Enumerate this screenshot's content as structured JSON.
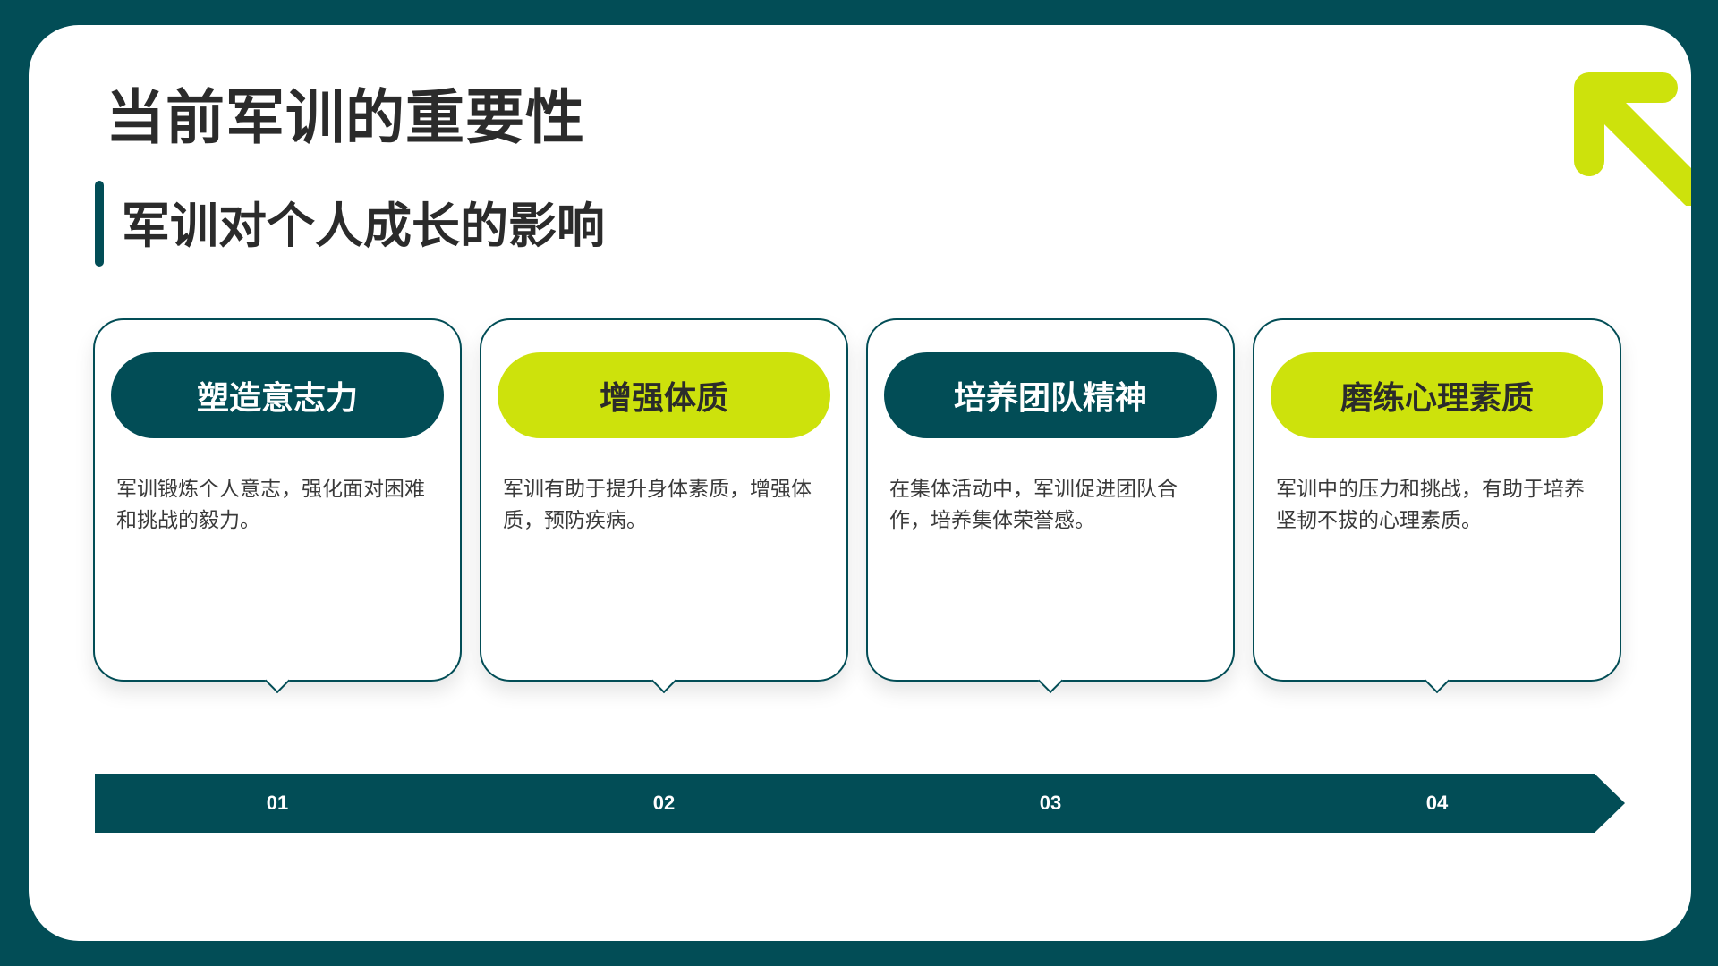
{
  "slide": {
    "title": "当前军训的重要性",
    "subtitle": "军训对个人成长的影响"
  },
  "cards": [
    {
      "heading": "塑造意志力",
      "text": "军训锻炼个人意志，强化面对困难和挑战的毅力。",
      "style": "dark"
    },
    {
      "heading": "增强体质",
      "text": "军训有助于提升身体素质，增强体质，预防疾病。",
      "style": "lime"
    },
    {
      "heading": "培养团队精神",
      "text": "在集体活动中，军训促进团队合作，培养集体荣誉感。",
      "style": "dark"
    },
    {
      "heading": "磨练心理素质",
      "text": "军训中的压力和挑战，有助于培养坚韧不拔的心理素质。",
      "style": "lime"
    }
  ],
  "timeline": {
    "steps": [
      "01",
      "02",
      "03",
      "04"
    ]
  },
  "icons": {
    "corner": "arrow-up-left-icon"
  },
  "colors": {
    "primary": "#024d56",
    "accent": "#cde20c",
    "text": "#2b2b2b",
    "background": "#ffffff"
  }
}
